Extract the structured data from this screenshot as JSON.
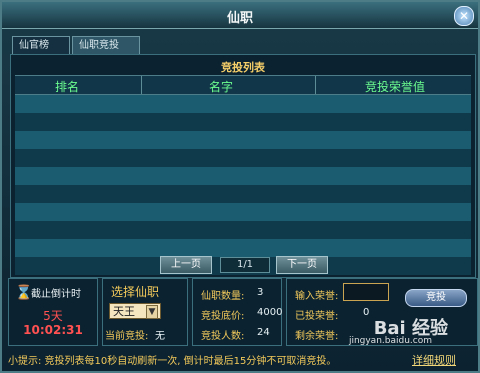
{
  "window": {
    "title": "仙职"
  },
  "tabs": [
    {
      "label": "仙官榜"
    },
    {
      "label": "仙职竞投"
    }
  ],
  "panel": {
    "title": "竞投列表"
  },
  "table": {
    "headers": [
      "排名",
      "名字",
      "竞投荣誉值"
    ],
    "rows": 10
  },
  "pager": {
    "prev": "上一页",
    "page": "1/1",
    "next": "下一页"
  },
  "countdown": {
    "label": "截止倒计时",
    "days": "5天",
    "time": "10:02:31"
  },
  "select": {
    "title": "选择仙职",
    "value": "天王",
    "current_label": "当前竞投:",
    "current_value": "无"
  },
  "stats": {
    "count_label": "仙职数量:",
    "count_value": "3",
    "base_label": "竞投底价:",
    "base_value": "4000",
    "people_label": "竞投人数:",
    "people_value": "24"
  },
  "bid": {
    "input_label": "输入荣誉:",
    "button": "竞投",
    "spent_label": "已投荣誉:",
    "spent_value": "0",
    "remain_label": "剩余荣誉:"
  },
  "footer": {
    "tip": "小提示: 竞投列表每10秒自动刷新一次, 倒计时最后15分钟不可取消竞投。",
    "rules": "详细规则"
  },
  "watermark": {
    "text": "Bai 经验",
    "sub": "jingyan.baidu.com"
  }
}
